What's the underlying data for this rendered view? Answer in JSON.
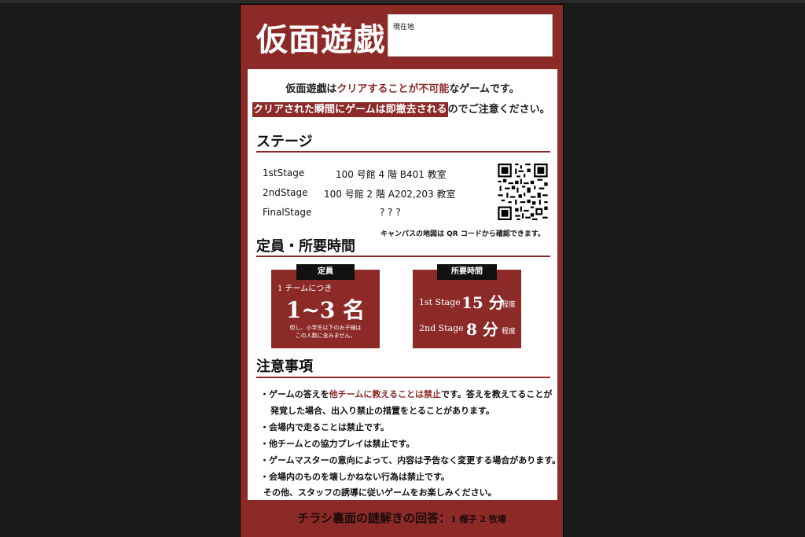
{
  "flyer": {
    "title": "仮面遊戯",
    "location_label": "現在地",
    "intro": {
      "line1_a": "仮面遊戯は",
      "line1_b": "クリアすることが不可能",
      "line1_c": "なゲームです。",
      "line2_a": "クリアされた瞬間にゲームは即撤去される",
      "line2_b": "のでご注意ください。"
    },
    "stage_section": {
      "heading": "ステージ",
      "stages": [
        {
          "name": "1stStage",
          "place": "100 号館 4 階 B401 教室"
        },
        {
          "name": "2ndStage",
          "place": "100 号館 2 階 A202,203 教室"
        },
        {
          "name": "FinalStage",
          "place": "? ? ?"
        }
      ],
      "qr_note": "キャンパスの地図は QR コードから確認できます。"
    },
    "capacity_section": {
      "heading": "定員・所要時間",
      "capacity": {
        "tab": "定員",
        "per_team": "1 チームにつき",
        "count": "1~3 名",
        "note_line1": "但し、小学生以下のお子様は",
        "note_line2": "この人数に含みません。"
      },
      "duration": {
        "tab": "所要時間",
        "rows": [
          {
            "stage": "1st Stage",
            "minutes": "15 分",
            "suffix": "程度"
          },
          {
            "stage": "2nd Stage",
            "minutes": "8 分",
            "suffix": "程度"
          }
        ]
      }
    },
    "notes_section": {
      "heading": "注意事項",
      "item1_a": "・ゲームの答えを",
      "item1_b": "他チームに教えることは禁止",
      "item1_c": "です。答えを教えてることが",
      "item1_cont": "発覚した場合、出入り禁止の措置をとることがあります。",
      "items": [
        "・会場内で走ることは禁止です。",
        "・他チームとの協力プレイは禁止です。",
        "・ゲームマスターの意向によって、内容は予告なく変更する場合があります。",
        "・会場内のものを壊しかねない行為は禁止です。"
      ],
      "closing": "その他、スタッフの誘導に従いゲームをお楽しみください。"
    },
    "footer": {
      "text": "チラシ裏面の謎解きの回答：",
      "answer": "1 帽子 2 牧場"
    }
  },
  "colors": {
    "brand_red": "#8c2a27",
    "background": "#1a1a1a",
    "tab_black": "#111111"
  }
}
